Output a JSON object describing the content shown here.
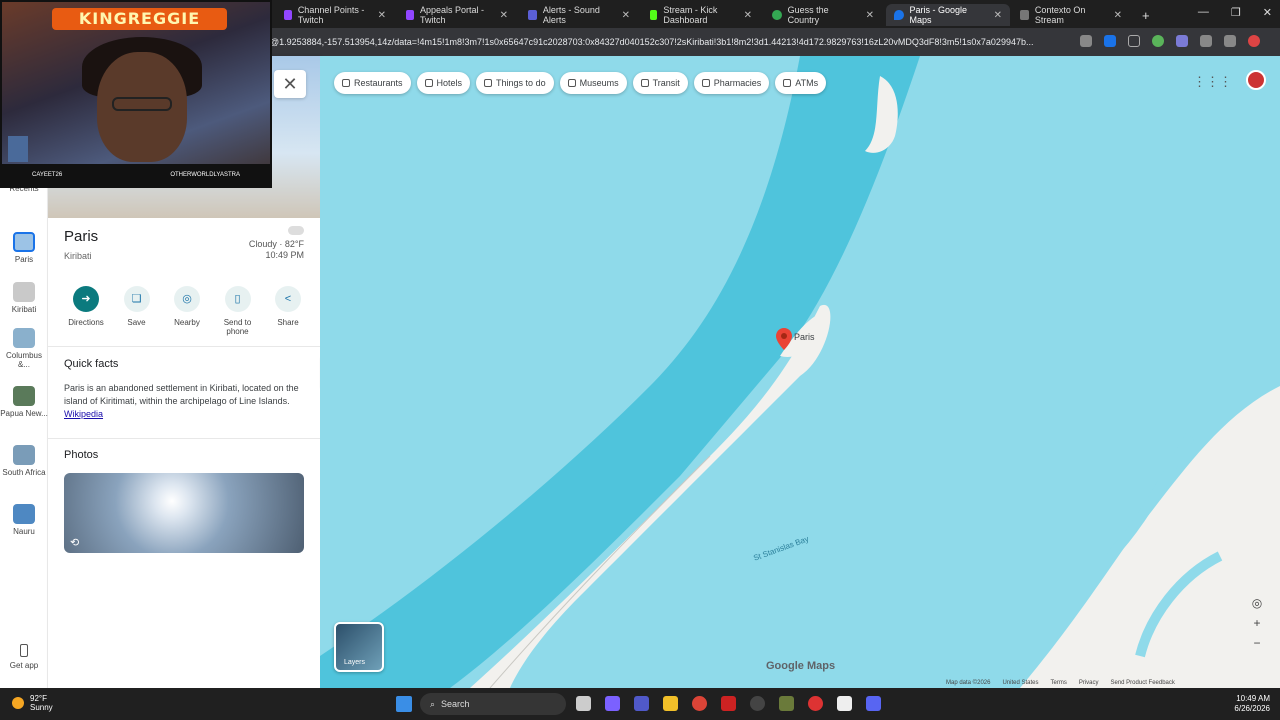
{
  "browser": {
    "tabs": [
      {
        "label": "Channel Points - Twitch",
        "icon_color": "#9146ff"
      },
      {
        "label": "Appeals Portal - Twitch",
        "icon_color": "#9146ff"
      },
      {
        "label": "Alerts - Sound Alerts",
        "icon_color": "#5b5fd6"
      },
      {
        "label": "Stream - Kick Dashboard",
        "icon_color": "#53fc18"
      },
      {
        "label": "Guess the Country",
        "icon_color": "#34a853"
      },
      {
        "label": "Paris - Google Maps",
        "icon_color": "#1a73e8"
      },
      {
        "label": "Contexto On Stream",
        "icon_color": "#777777"
      }
    ],
    "url": "@1.9253884,-157.513954,14z/data=!4m15!1m8!3m7!1s0x65647c91c2028703:0x84327d040152c307!2sKiribati!3b1!8m2!3d1.44213!4d172.9829763!16zL20vMDQ3dF8!3m5!1s0x7a029947b..."
  },
  "webcam": {
    "banner": "KINGREGGIE",
    "left_name": "CAYEET26",
    "right_name": "OTHERWORLDLYASTRA"
  },
  "rail": {
    "recents_label": "Recents",
    "items": [
      "Paris",
      "Kiribati",
      "Columbus &...",
      "Papua New...",
      "South Africa",
      "Nauru"
    ],
    "get_app": "Get app"
  },
  "place": {
    "name": "Paris",
    "region": "Kiribati",
    "weather": "Cloudy · 82°F",
    "time": "10:49 PM",
    "actions": [
      "Directions",
      "Save",
      "Nearby",
      "Send to phone",
      "Share"
    ],
    "quick_facts_title": "Quick facts",
    "quick_facts": "Paris is an abandoned settlement in Kiribati, located on the island of Kiritimati, within the archipelago of Line Islands.",
    "wiki_link": "Wikipedia",
    "photos_title": "Photos"
  },
  "map": {
    "chips": [
      "Restaurants",
      "Hotels",
      "Things to do",
      "Museums",
      "Transit",
      "Pharmacies",
      "ATMs"
    ],
    "pin_label": "Paris",
    "bay_label": "St Stanislas Bay",
    "layers_label": "Layers",
    "logo": "Google Maps",
    "attribution": [
      "Map data ©2026",
      "United States",
      "Terms",
      "Privacy",
      "Send Product Feedback"
    ],
    "colors": {
      "water": "#8fdaea",
      "deep_water": "#4fc4dc",
      "land": "#f2f1ee"
    }
  },
  "taskbar": {
    "temp": "92°F",
    "condition": "Sunny",
    "search_label": "Search",
    "date": "6/26/2026",
    "time": "10:49 AM"
  }
}
